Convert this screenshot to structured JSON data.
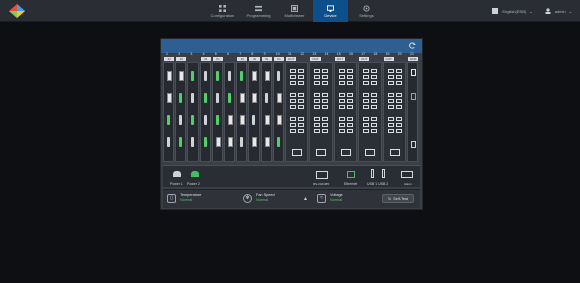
{
  "topbar": {
    "nav": [
      {
        "label": "Configuration",
        "icon": "grid-icon",
        "active": false
      },
      {
        "label": "Programming",
        "icon": "program-icon",
        "active": false
      },
      {
        "label": "Multiviewer",
        "icon": "multiviewer-icon",
        "active": false
      },
      {
        "label": "Device",
        "icon": "device-icon",
        "active": true
      },
      {
        "label": "Settings",
        "icon": "gear-icon",
        "active": false
      }
    ],
    "language": "English(ENB)",
    "user": "admin"
  },
  "device": {
    "slot_numbers": [
      "1",
      "2",
      "3",
      "4",
      "5",
      "6",
      "7",
      "8",
      "9",
      "10",
      "11",
      "12",
      "13",
      "14",
      "15",
      "16",
      "17",
      "18",
      "19",
      "20",
      "21"
    ],
    "slot_tags": [
      "IN",
      "IN",
      "",
      "IN",
      "IN",
      "",
      "IN",
      "IN",
      "IN",
      "IN",
      "OUT",
      "",
      "OUT",
      "",
      "OUT",
      "",
      "OUT",
      "",
      "OUT",
      "",
      "NXM"
    ],
    "io": {
      "power1": "Power 1",
      "power2": "Power 2",
      "rs232": "RS-232/485",
      "ethernet": "Ethernet",
      "usb": "USB 1  USB 2",
      "alarm": "Alarm"
    },
    "status": {
      "temperature_label": "Temperature",
      "temperature_value": "Normal",
      "fan_label": "Fan Speed",
      "fan_value": "Normal",
      "voltage_label": "Voltage",
      "voltage_value": "Normal",
      "button": "Self-Test"
    }
  },
  "colors": {
    "accent": "#0d4f8a",
    "header": "#2d5f93",
    "ok": "#49c46a"
  }
}
